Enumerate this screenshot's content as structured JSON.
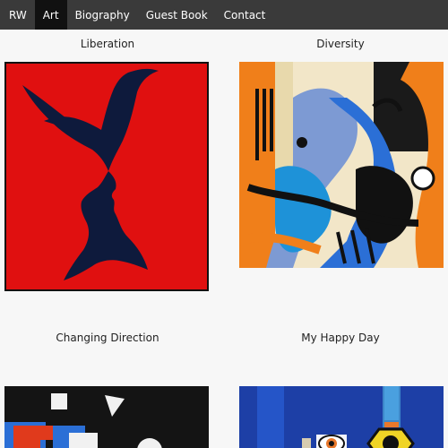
{
  "nav": {
    "brand": "RW",
    "items": [
      "Art",
      "Biography",
      "Guest Book",
      "Contact"
    ],
    "active": "Art"
  },
  "artworks": [
    {
      "title": "Liberation"
    },
    {
      "title": "Diversity"
    },
    {
      "title": "Changing Direction"
    },
    {
      "title": "My Happy Day"
    }
  ],
  "colors": {
    "nav_bg": "#3a3a3a",
    "nav_active": "#111111",
    "page_bg": "#f7f7f7",
    "liberation_red": "#e01010",
    "liberation_navy": "#0e1a3c"
  }
}
